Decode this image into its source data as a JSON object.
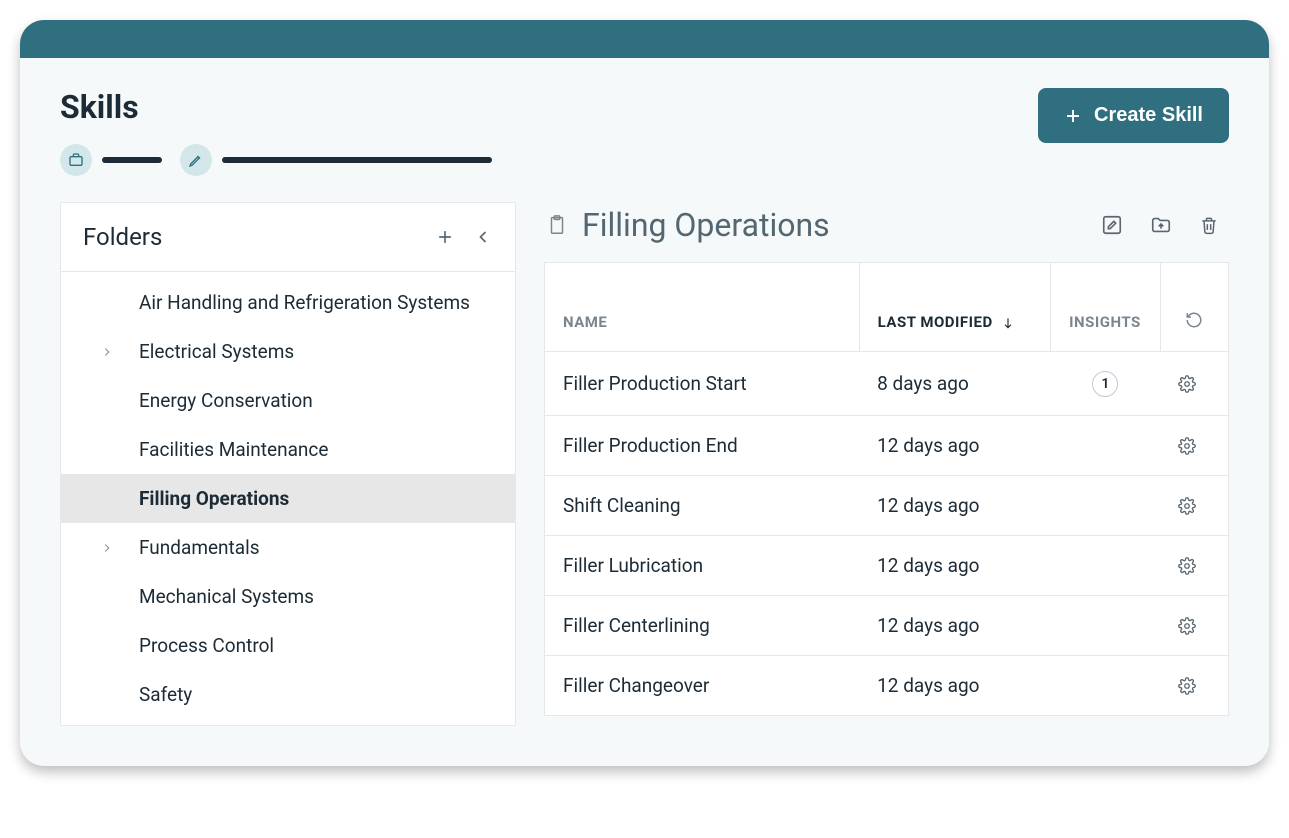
{
  "pageTitle": "Skills",
  "createButtonLabel": "Create Skill",
  "sidebar": {
    "title": "Folders",
    "items": [
      {
        "label": "Air Handling and Refrigeration Systems",
        "expandable": false,
        "selected": false
      },
      {
        "label": "Electrical Systems",
        "expandable": true,
        "selected": false
      },
      {
        "label": "Energy Conservation",
        "expandable": false,
        "selected": false
      },
      {
        "label": "Facilities Maintenance",
        "expandable": false,
        "selected": false
      },
      {
        "label": "Filling Operations",
        "expandable": false,
        "selected": true
      },
      {
        "label": "Fundamentals",
        "expandable": true,
        "selected": false
      },
      {
        "label": "Mechanical Systems",
        "expandable": false,
        "selected": false
      },
      {
        "label": "Process Control",
        "expandable": false,
        "selected": false
      },
      {
        "label": "Safety",
        "expandable": false,
        "selected": false
      }
    ]
  },
  "main": {
    "title": "Filling Operations",
    "columns": {
      "name": "NAME",
      "lastModified": "LAST MODIFIED",
      "insights": "INSIGHTS"
    },
    "sortColumn": "lastModified",
    "rows": [
      {
        "name": "Filler Production Start",
        "lastModified": "8 days ago",
        "insights": "1"
      },
      {
        "name": "Filler Production End",
        "lastModified": "12 days ago",
        "insights": ""
      },
      {
        "name": "Shift Cleaning",
        "lastModified": "12 days ago",
        "insights": ""
      },
      {
        "name": "Filler Lubrication",
        "lastModified": "12 days ago",
        "insights": ""
      },
      {
        "name": "Filler Centerlining",
        "lastModified": "12 days ago",
        "insights": ""
      },
      {
        "name": "Filler Changeover",
        "lastModified": "12 days ago",
        "insights": ""
      }
    ]
  }
}
